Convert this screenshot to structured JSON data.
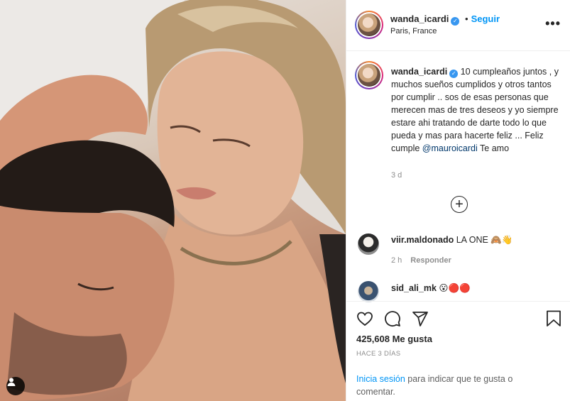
{
  "post": {
    "author": "wanda_icardi",
    "location": "Paris, France",
    "follow_separator": "•",
    "follow_label": "Seguir",
    "more_label": "•••",
    "verified_mark": "✓"
  },
  "caption": {
    "username": "wanda_icardi",
    "text_before": "10 cumpleaños juntos , y muchos sueños cumplidos y otros tantos por cumplir .. sos de esas personas que merecen mas de tres deseos y yo siempre estare ahi tratando de darte todo lo que pueda y mas para hacerte feliz ... Feliz cumple ",
    "mention": "@mauroicardi",
    "text_after": " Te amo",
    "time_ago": "3 d"
  },
  "load_more_label": "+",
  "comments": [
    {
      "username": "viir.maldonado",
      "text": "LA ONE 🙈👋",
      "time": "2 h",
      "reply_label": "Responder"
    },
    {
      "username": "sid_ali_mk",
      "text": "😮🔴🔴"
    }
  ],
  "stats": {
    "likes": "425,608 Me gusta",
    "date": "HACE 3 DÍAS"
  },
  "login_prompt": {
    "link": "Inicia sesión",
    "rest": " para indicar que te gusta o comentar."
  },
  "icons": [
    "heart-icon",
    "comment-icon",
    "share-icon",
    "bookmark-icon",
    "person-icon",
    "plus-icon"
  ]
}
